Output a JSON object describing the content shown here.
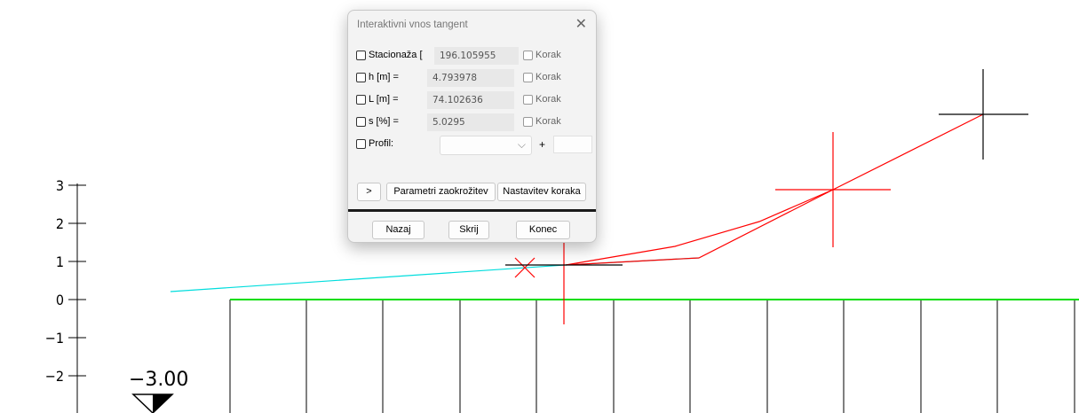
{
  "dialog": {
    "title": "Interaktivni vnos tangent",
    "close_icon": "close-icon",
    "rows": [
      {
        "label": "Stacionaža [",
        "value": "196.105955",
        "step_label": "Korak"
      },
      {
        "label": "h [m] =",
        "value": "4.793978",
        "step_label": "Korak"
      },
      {
        "label": "L [m] =",
        "value": "74.102636",
        "step_label": "Korak"
      },
      {
        "label": "s [%] =",
        "value": "5.0295",
        "step_label": "Korak"
      }
    ],
    "profile": {
      "label": "Profil:",
      "selected": "",
      "plus": "+",
      "offset": ""
    },
    "buttons": {
      "expand": ">",
      "rounding": "Parametri zaokrožitev",
      "step_settings": "Nastavitev koraka"
    },
    "footer": {
      "back": "Nazaj",
      "hide": "Skrij",
      "end": "Konec"
    }
  },
  "drawing": {
    "y_axis_labels": [
      "3",
      "2",
      "1",
      "0",
      "−1",
      "−2"
    ],
    "level_marker": "−3.00",
    "colors": {
      "terrain": "#00dd00",
      "profile": "#00dddd",
      "tangent": "#ff0000",
      "crosshair": "#000000"
    }
  }
}
